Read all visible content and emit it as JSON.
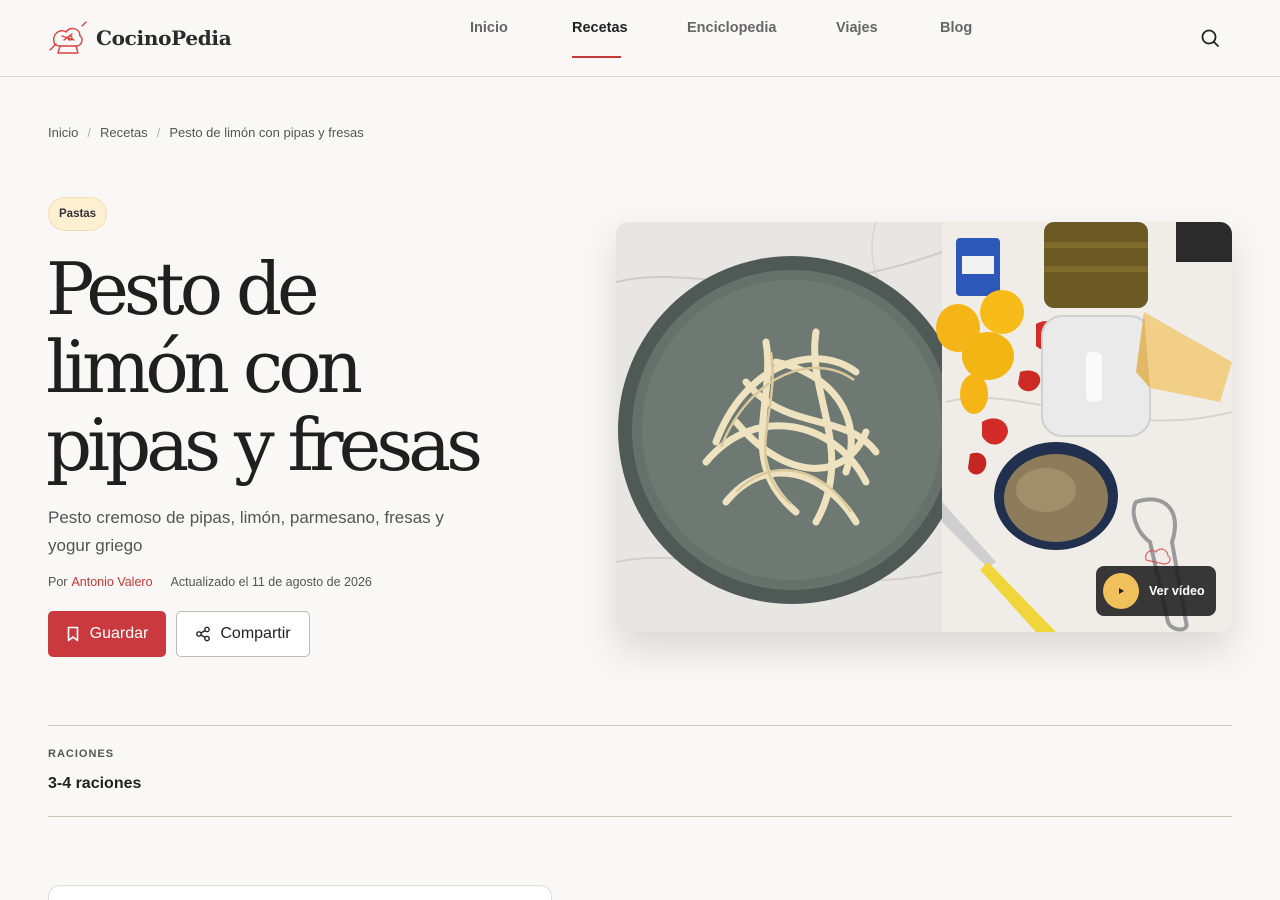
{
  "header": {
    "logo_text": "CocinoPedia",
    "nav": [
      {
        "label": "Inicio",
        "active": false
      },
      {
        "label": "Recetas",
        "active": true
      },
      {
        "label": "Enciclopedia",
        "active": false
      },
      {
        "label": "Viajes",
        "active": false
      },
      {
        "label": "Blog",
        "active": false
      }
    ],
    "search_icon": "search-icon"
  },
  "breadcrumb": [
    "Inicio",
    "Recetas",
    "Pesto de limón con pipas y fresas"
  ],
  "recipe": {
    "category": "Pastas",
    "title_lines": [
      "Pesto de",
      "limón con",
      "pipas y fresas"
    ],
    "subtitle": "Pesto cremoso de pipas, limón, parmesano, fresas y yogur griego",
    "author_prefix": "Por",
    "author": "Antonio Valero",
    "updated": "Actualizado el 11 de agosto de 2026",
    "save_label": "Guardar",
    "share_label": "Compartir",
    "video_label": "Ver vídeo"
  },
  "servings": {
    "label": "RACIONES",
    "value": "3-4 raciones"
  },
  "colors": {
    "accent": "#c9393d",
    "background": "#faf8f6",
    "tag_bg": "#fdf0d2",
    "play": "#f0c15a"
  }
}
